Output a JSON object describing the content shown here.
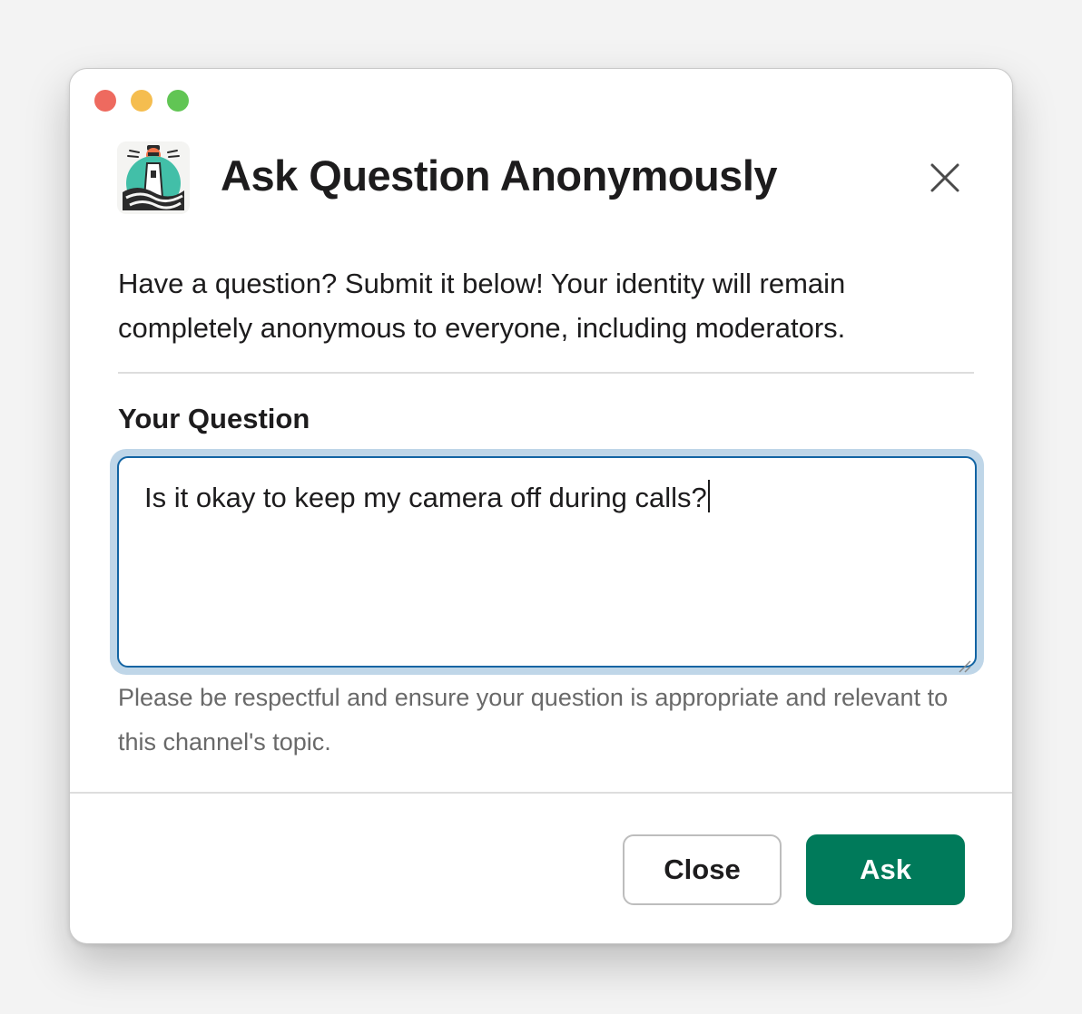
{
  "window": {
    "traffic_lights": [
      {
        "name": "close",
        "color": "#ee6a5f"
      },
      {
        "name": "minimize",
        "color": "#f5bd4f"
      },
      {
        "name": "zoom",
        "color": "#61c554"
      }
    ]
  },
  "header": {
    "app_icon": "lighthouse-logo",
    "title": "Ask Question Anonymously",
    "close_icon": "close-icon"
  },
  "body": {
    "description": "Have a question? Submit it below! Your identity will remain completely anonymous to everyone, including moderators.",
    "question_label": "Your Question",
    "question_value": "Is it okay to keep my camera off during calls?",
    "hint": "Please be respectful and ensure your question is appropriate and relevant to this channel's topic."
  },
  "footer": {
    "close_label": "Close",
    "ask_label": "Ask"
  },
  "colors": {
    "accent_primary": "#007a5a",
    "focus_border": "#1264a3",
    "focus_ring": "#bfd6e8"
  }
}
